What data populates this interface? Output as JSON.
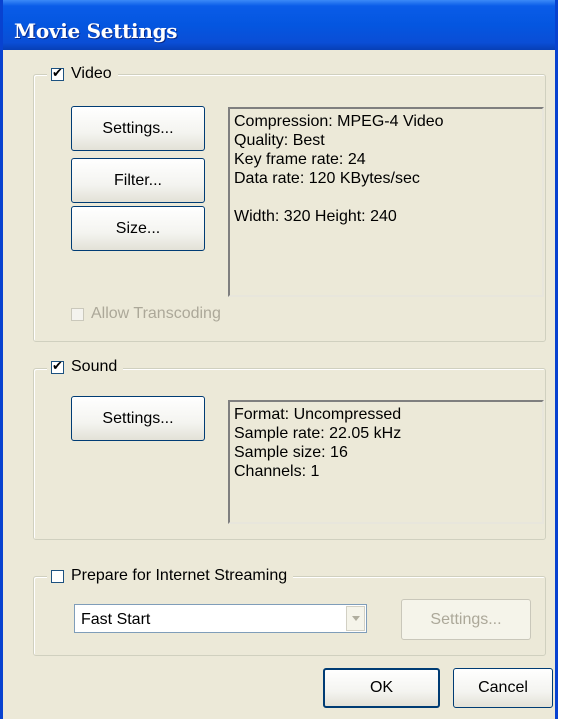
{
  "window": {
    "title": "Movie Settings"
  },
  "video": {
    "label": "Video",
    "checked": true,
    "buttons": {
      "settings": "Settings...",
      "filter": "Filter...",
      "size": "Size..."
    },
    "info": {
      "compression": "Compression: MPEG-4 Video",
      "quality": "Quality: Best",
      "key_frame_rate": "Key frame rate: 24",
      "data_rate": "Data rate: 120 KBytes/sec",
      "dimensions": "Width: 320 Height: 240"
    },
    "allow_transcoding": {
      "label": "Allow Transcoding",
      "checked": false,
      "enabled": false
    }
  },
  "sound": {
    "label": "Sound",
    "checked": true,
    "buttons": {
      "settings": "Settings..."
    },
    "info": {
      "format": "Format: Uncompressed",
      "sample_rate": "Sample rate: 22.05 kHz",
      "sample_size": "Sample size: 16",
      "channels": "Channels: 1"
    }
  },
  "streaming": {
    "label": "Prepare for Internet Streaming",
    "checked": false,
    "selected_option": "Fast Start",
    "settings_label": "Settings..."
  },
  "footer": {
    "ok_label": "OK",
    "cancel_label": "Cancel"
  }
}
